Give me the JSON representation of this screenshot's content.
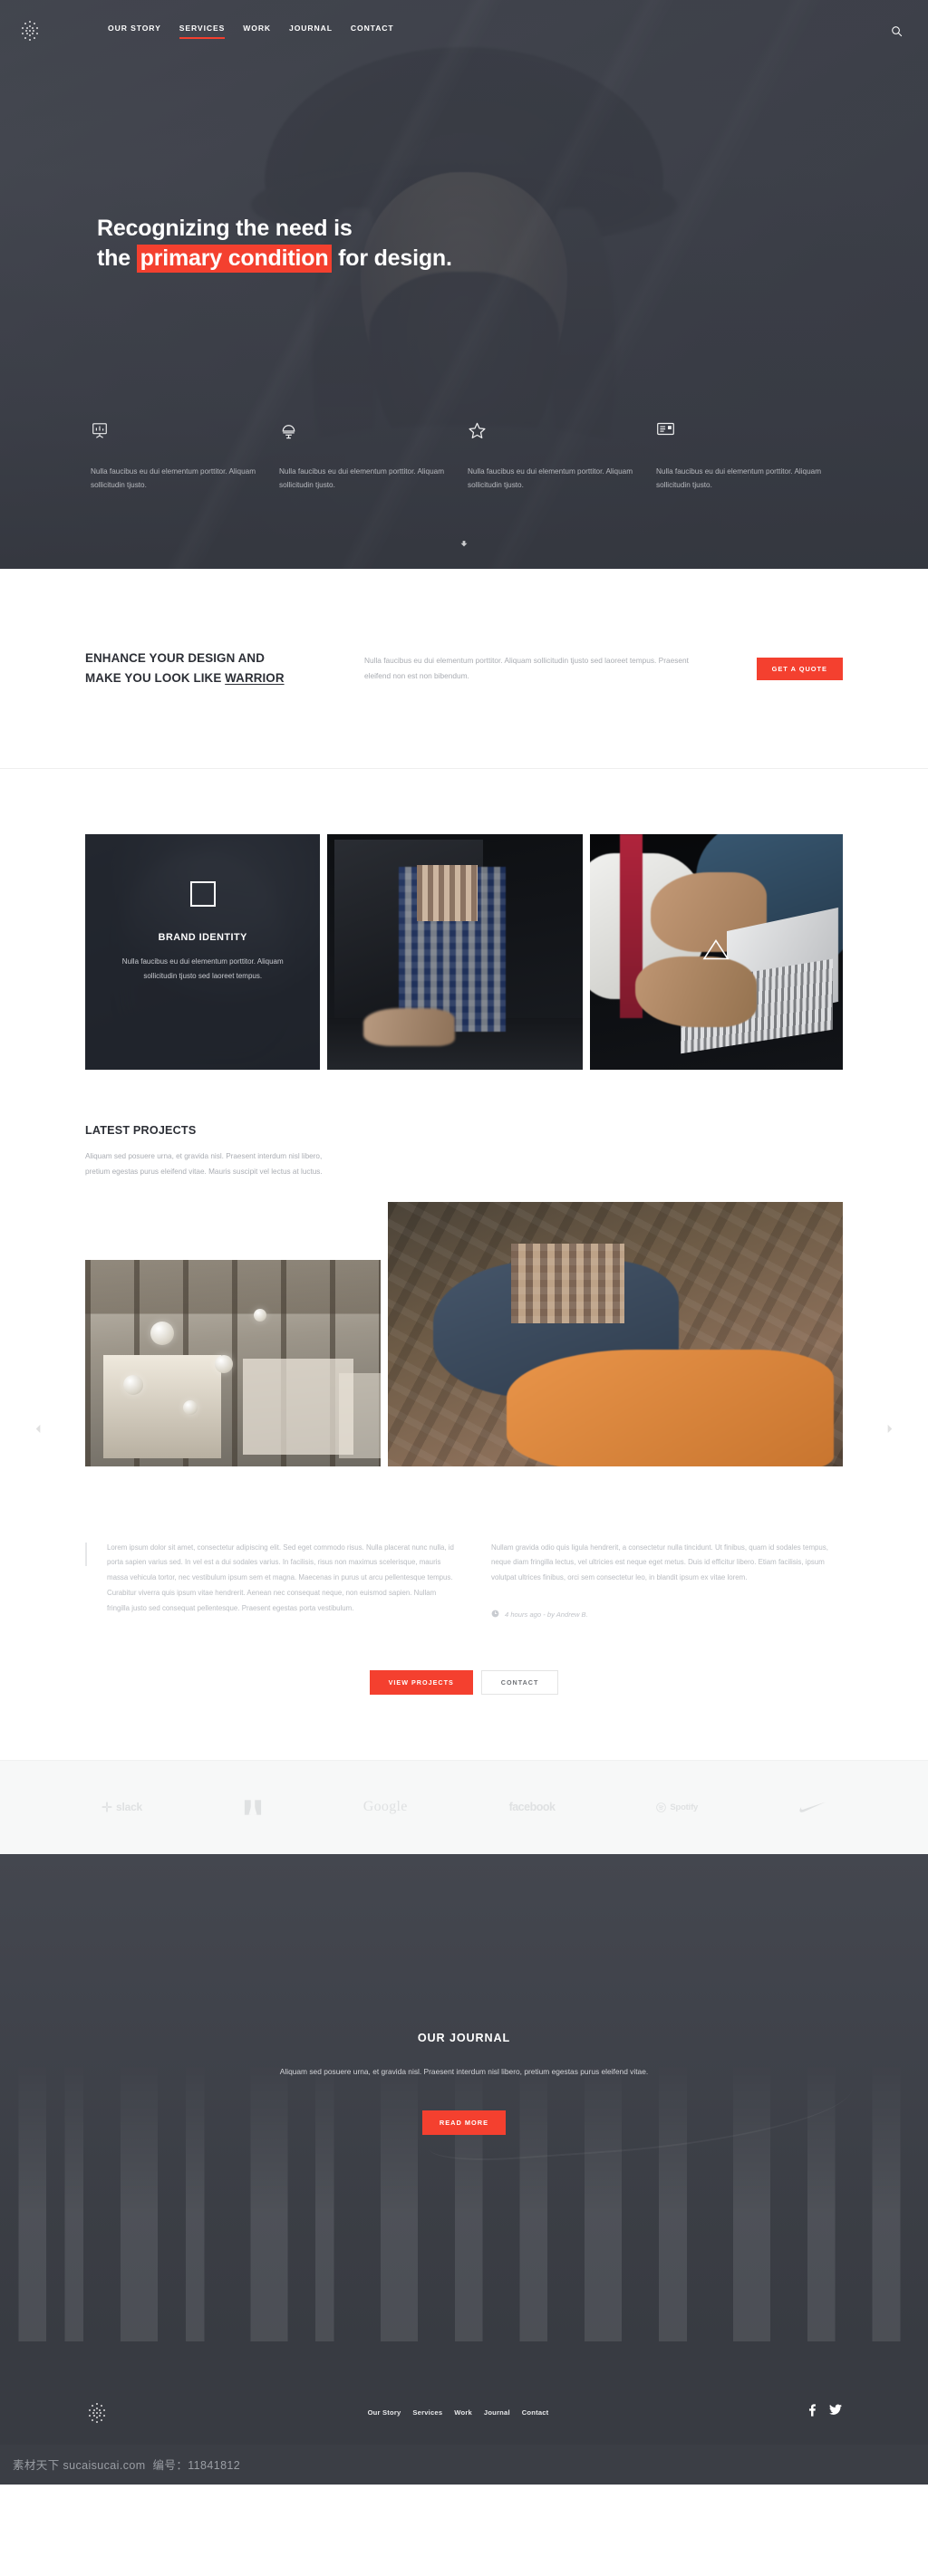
{
  "brand": {
    "logo_name": "dotted-circle-logo"
  },
  "nav": {
    "items": [
      {
        "label": "OUR STORY",
        "active": false
      },
      {
        "label": "SERVICES",
        "active": true
      },
      {
        "label": "WORK",
        "active": false
      },
      {
        "label": "JOURNAL",
        "active": false
      },
      {
        "label": "CONTACT",
        "active": false
      }
    ],
    "search_icon": "search-icon"
  },
  "hero": {
    "headline_line1": "Recognizing the need is",
    "headline_line2_pre": "the ",
    "headline_highlight": "primary condition",
    "headline_line2_post": " for design.",
    "scroll_hint": "scroll-down-arrow",
    "features": [
      {
        "icon": "presentation-chart-icon",
        "text": "Nulla faucibus eu dui elementum porttitor. Aliquam sollicitudin tjusto."
      },
      {
        "icon": "desk-lamp-icon",
        "text": "Nulla faucibus eu dui elementum porttitor. Aliquam sollicitudin tjusto."
      },
      {
        "icon": "star-icon",
        "text": "Nulla faucibus eu dui elementum porttitor. Aliquam sollicitudin tjusto."
      },
      {
        "icon": "id-card-icon",
        "text": "Nulla faucibus eu dui elementum porttitor. Aliquam sollicitudin tjusto."
      }
    ]
  },
  "enhance": {
    "heading_line1": "ENHANCE YOUR DESIGN AND",
    "heading_line2_pre": "MAKE YOU LOOK LIKE ",
    "heading_line2_underlined": "WARRIOR",
    "body": "Nulla faucibus eu dui elementum porttitor. Aliquam sollicitudin tjusto sed laoreet tempus. Praesent eleifend non est non bibendum.",
    "cta_label": "GET A QUOTE"
  },
  "cards": [
    {
      "icon": "square-outline-icon",
      "title": "BRAND IDENTITY",
      "text": "Nulla faucibus eu dui elementum porttitor. Aliquam sollicitudin tjusto sed laoreet tempus."
    },
    {
      "icon": "meeting-photo",
      "title": "",
      "text": ""
    },
    {
      "icon": "triangle-outline-icon",
      "title": "",
      "text": ""
    }
  ],
  "projects": {
    "heading": "LATEST PROJECTS",
    "lede": "Aliquam sed posuere urna, et gravida nisl. Praesent interdum nisl libero, pretium egestas purus eleifend vitae. Mauris suscipit vel lectus at luctus.",
    "prev_icon": "carousel-prev-arrow",
    "next_icon": "carousel-next-arrow"
  },
  "textcols": {
    "left": "Lorem ipsum dolor sit amet, consectetur adipiscing elit. Sed eget commodo risus. Nulla placerat nunc nulla, id porta sapien varius sed. In vel est a dui sodales varius. In facilisis, risus non maximus scelerisque, mauris massa vehicula tortor, nec vestibulum ipsum sem et magna. Maecenas in purus ut arcu pellentesque tempus. Curabitur viverra quis ipsum vitae hendrerit. Aenean nec consequat neque, non euismod sapien. Nullam fringilla justo sed consequat pellentesque. Praesent egestas porta vestibulum.",
    "right": "Nullam gravida odio quis ligula hendrerit, a consectetur nulla tincidunt. Ut finibus, quam id sodales tempus, neque diam fringilla lectus, vel ultricies est neque eget metus. Duis id efficitur libero. Etiam facilisis, ipsum volutpat ultrices finibus, orci sem consectetur leo, in blandit ipsum ex vitae lorem.",
    "meta_icon": "clock-icon",
    "meta": "4 hours ago - by Andrew B."
  },
  "cta": {
    "primary_label": "VIEW PROJECTS",
    "secondary_label": "CONTACT"
  },
  "logos": [
    {
      "name": "slack-logo",
      "label": "slack"
    },
    {
      "name": "adobe-logo",
      "label": ""
    },
    {
      "name": "google-logo",
      "label": "Google"
    },
    {
      "name": "facebook-logo",
      "label": "facebook"
    },
    {
      "name": "spotify-logo",
      "label": "Spotify"
    },
    {
      "name": "nike-logo",
      "label": ""
    }
  ],
  "journal": {
    "heading": "OUR JOURNAL",
    "body": "Aliquam sed posuere urna, et gravida nisl. Praesent interdum nisl libero, pretium egestas purus eleifend vitae.",
    "cta_label": "READ MORE"
  },
  "footer": {
    "nav": [
      {
        "label": "Our Story"
      },
      {
        "label": "Services"
      },
      {
        "label": "Work"
      },
      {
        "label": "Journal"
      },
      {
        "label": "Contact"
      }
    ],
    "social": [
      {
        "name": "facebook-icon"
      },
      {
        "name": "twitter-icon"
      }
    ]
  },
  "watermark": {
    "site": "素材天下 sucaisucai.com",
    "id": "编号：11841812"
  },
  "colors": {
    "accent": "#f4402f",
    "dark": "#383b42",
    "heading": "#2c2f36",
    "muted": "#aaadb3"
  }
}
